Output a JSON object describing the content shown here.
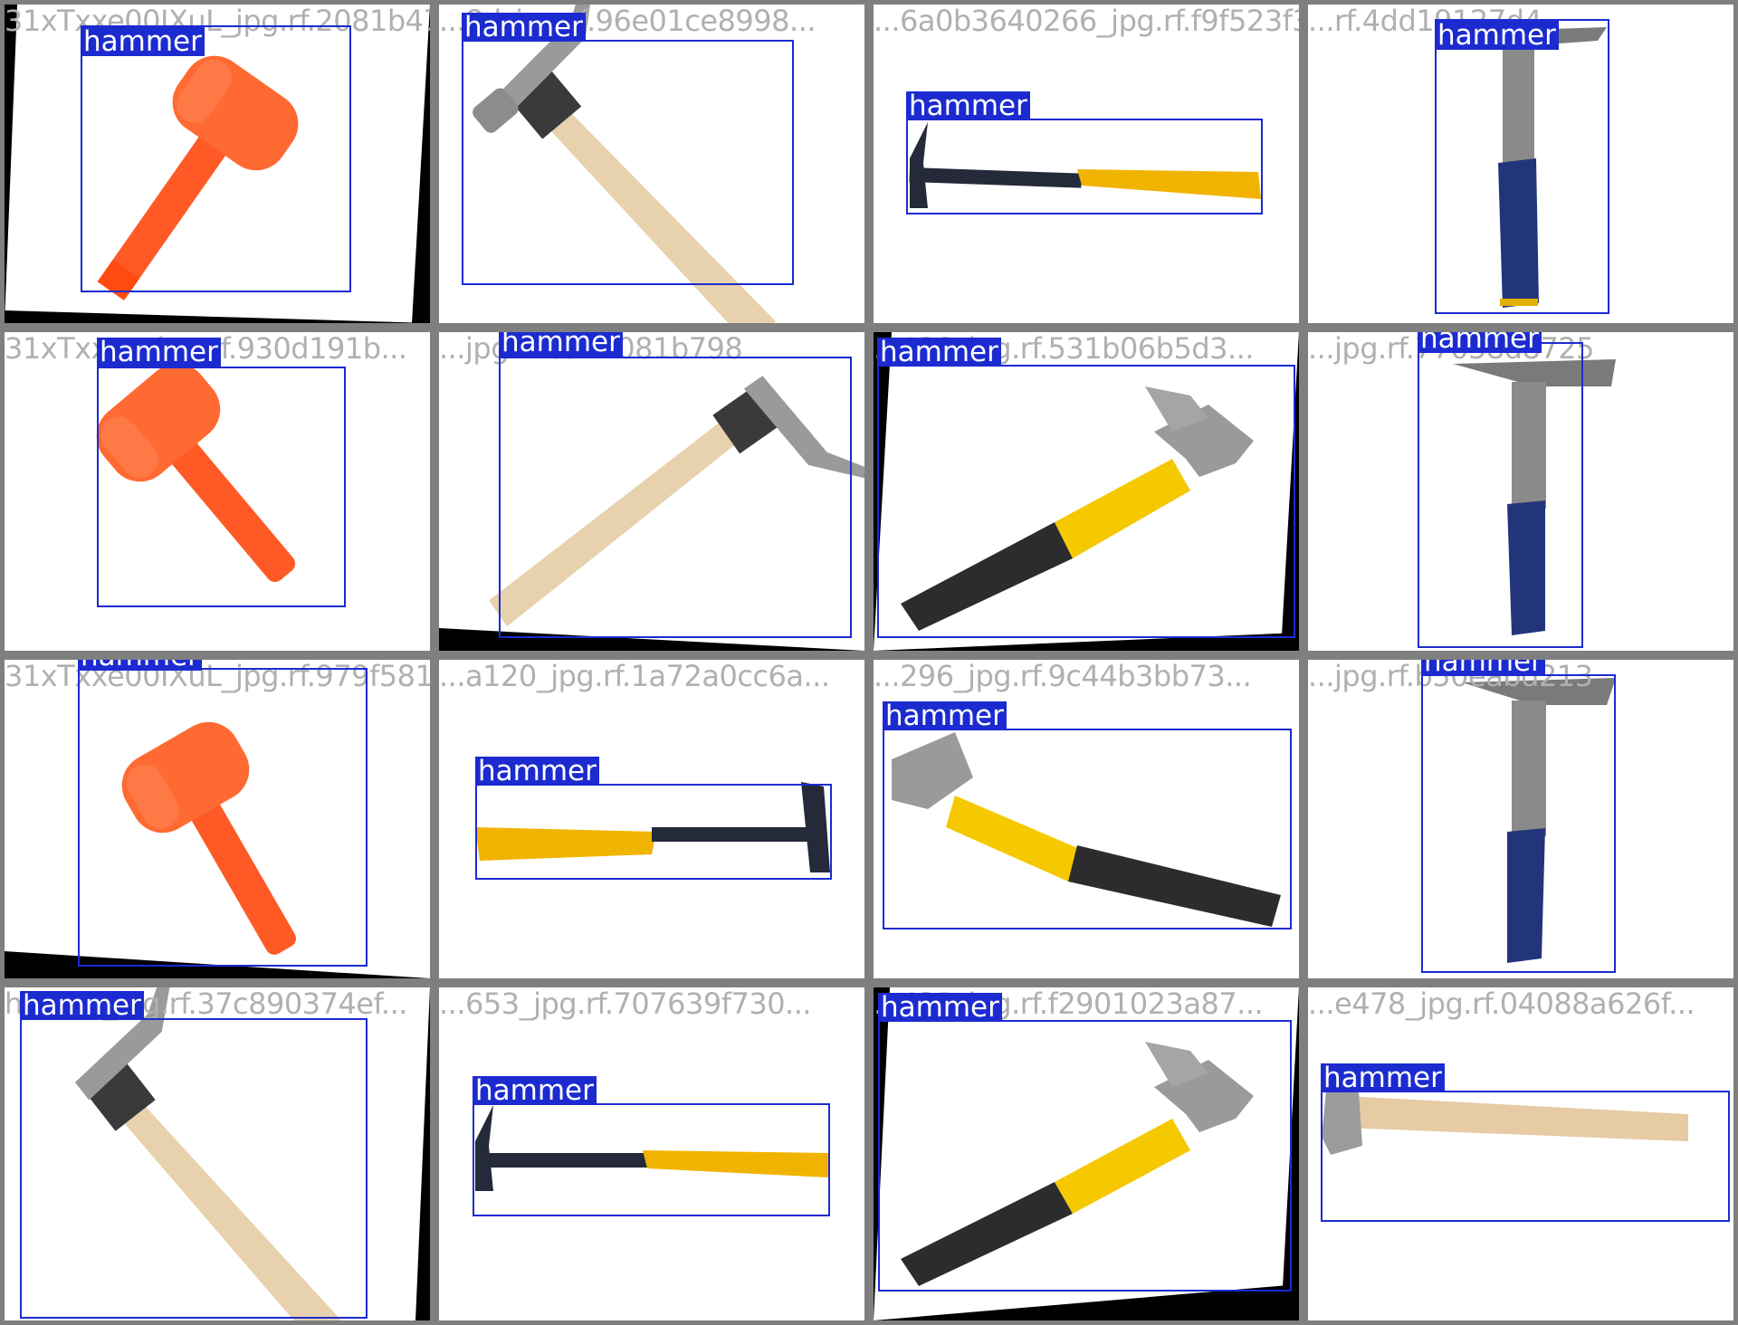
{
  "label_text": "hammer",
  "colors": {
    "box": "#1c2bd0",
    "background": "#7f7f7f"
  },
  "tiles": [
    {
      "filename": "31xTxxe00IXuL_jpg.rf.2081b478...",
      "object": "orange-dead-blow-mallet-icon",
      "label": "hammer"
    },
    {
      "filename": "...8d_jpg.rf.96e01ce8998...",
      "object": "wood-handle-claw-hammer-icon",
      "label": "hammer"
    },
    {
      "filename": "...6a0b3640266_jpg.rf.f9f523f338ca28ad8f...",
      "object": "black-yellow-steel-hammer-icon",
      "label": "hammer"
    },
    {
      "filename": "...rf.4dd19127d4",
      "object": "blue-grip-rip-hammer-icon",
      "label": "hammer"
    },
    {
      "filename": "31xTxx... _jpg.rf.930d191b...",
      "object": "orange-dead-blow-mallet-icon",
      "label": "hammer"
    },
    {
      "filename": "...jpg.rf.e517081b798",
      "object": "wood-handle-claw-hammer-icon",
      "label": "hammer"
    },
    {
      "filename": "...428_jpg.rf.531b06b5d3...",
      "object": "stanley-claw-hammer-icon",
      "label": "hammer"
    },
    {
      "filename": "...jpg.rf.77058d8725",
      "object": "blue-grip-rip-hammer-icon",
      "label": "hammer"
    },
    {
      "filename": "31xTxxe00IXuL_jpg.rf.979f5817...",
      "object": "orange-dead-blow-mallet-icon",
      "label": "hammer"
    },
    {
      "filename": "...a120_jpg.rf.1a72a0cc6a...",
      "object": "black-yellow-steel-hammer-icon",
      "label": "hammer"
    },
    {
      "filename": "...296_jpg.rf.9c44b3bb73...",
      "object": "stanley-claw-hammer-icon",
      "label": "hammer"
    },
    {
      "filename": "...jpg.rf.b50eabd213",
      "object": "blue-grip-rip-hammer-icon",
      "label": "hammer"
    },
    {
      "filename": "h...111_jpg.rf.37c890374ef...",
      "object": "wood-handle-claw-hammer-icon",
      "label": "hammer"
    },
    {
      "filename": "...653_jpg.rf.707639f730...",
      "object": "black-yellow-steel-hammer-icon",
      "label": "hammer"
    },
    {
      "filename": "...423_jpg.rf.f2901023a87...",
      "object": "stanley-claw-hammer-icon",
      "label": "hammer"
    },
    {
      "filename": "...e478_jpg.rf.04088a626f...",
      "object": "wood-drywall-hammer-icon",
      "label": "hammer"
    }
  ]
}
